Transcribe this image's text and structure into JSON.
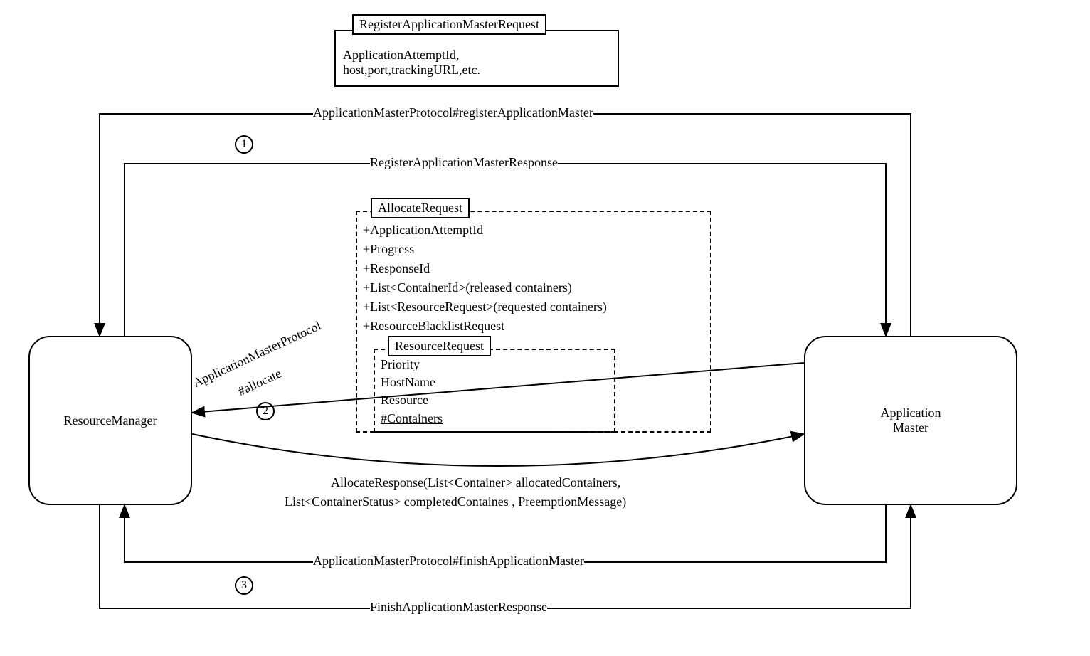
{
  "nodes": {
    "resource_manager": "ResourceManager",
    "application_master_line1": "Application",
    "application_master_line2": "Master"
  },
  "register_box": {
    "title": "RegisterApplicationMasterRequest",
    "line1": "ApplicationAttemptId,",
    "line2": "host,port,trackingURL,etc."
  },
  "allocate_box": {
    "title": "AllocateRequest",
    "fields": {
      "f1": "+ApplicationAttemptId",
      "f2": "+Progress",
      "f3": "+ResponseId",
      "f4": "+List<ContainerId>(released containers)",
      "f5": "+List<ResourceRequest>(requested containers)",
      "f6": "+ResourceBlacklistRequest"
    }
  },
  "resource_request_box": {
    "title": "ResourceRequest",
    "fields": {
      "f1": "Priority",
      "f2": "HostName",
      "f3": "Resource",
      "f4": "#Containers"
    }
  },
  "arrows": {
    "a1_request": "ApplicationMasterProtocol#registerApplicationMaster",
    "a1_response": "RegisterApplicationMasterResponse",
    "a2_request_line1": "ApplicationMasterProtocol",
    "a2_request_line2": "#allocate",
    "a2_response_line1": "AllocateResponse(List<Container> allocatedContainers,",
    "a2_response_line2": "List<ContainerStatus> completedContaines , PreemptionMessage)",
    "a3_request": "ApplicationMasterProtocol#finishApplicationMaster",
    "a3_response": "FinishApplicationMasterResponse"
  },
  "numbers": {
    "one": "1",
    "two": "2",
    "three": "3"
  }
}
